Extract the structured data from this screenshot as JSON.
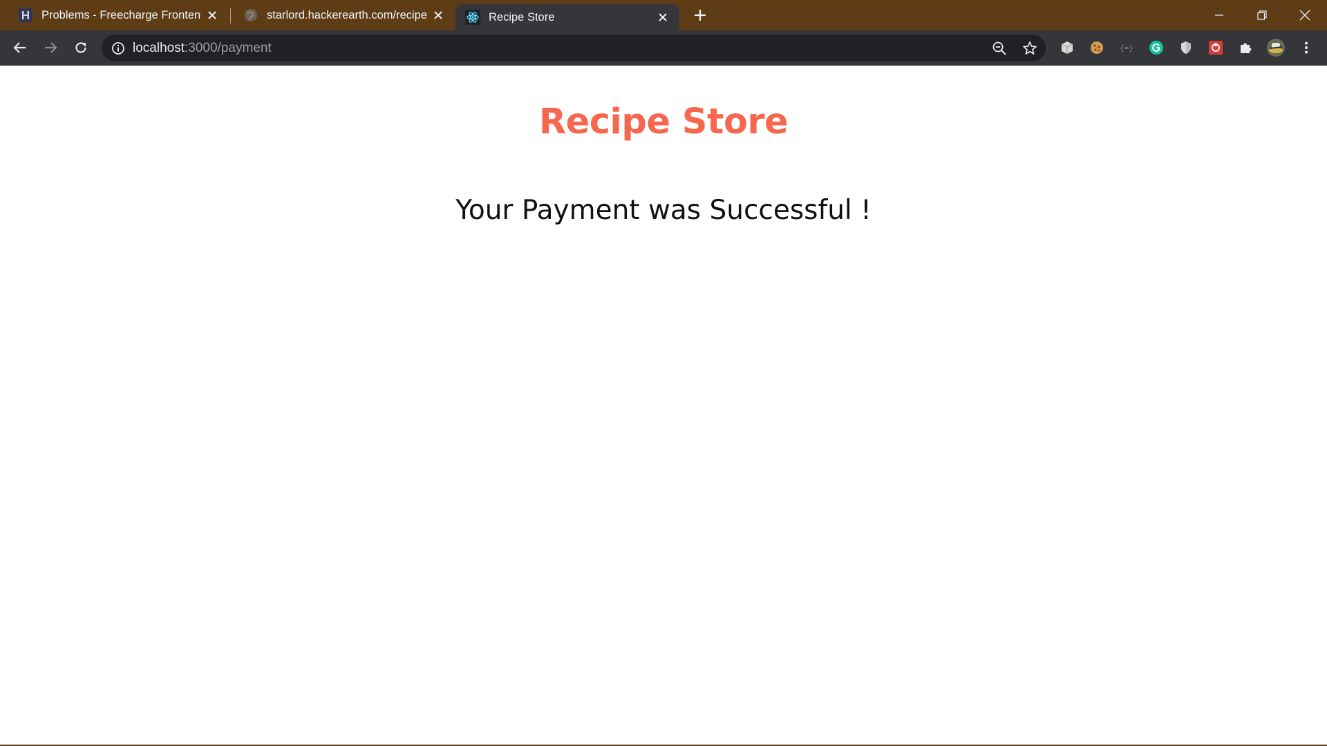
{
  "browser": {
    "tabs": [
      {
        "label": "Problems - Freecharge Frontend",
        "favicon": "hackerearth-icon",
        "active": false
      },
      {
        "label": "starlord.hackerearth.com/recipe",
        "favicon": "globe-icon",
        "active": false
      },
      {
        "label": "Recipe Store",
        "favicon": "react-icon",
        "active": true
      }
    ],
    "address_bar": {
      "host": "localhost",
      "path": ":3000/payment"
    },
    "extensions": [
      "cube-extension-icon",
      "cookie-extension-icon",
      "json-extension-icon",
      "grammarly-icon",
      "shield-extension-icon",
      "red-extension-icon",
      "puzzle-icon",
      "profile-avatar-icon",
      "menu-icon"
    ]
  },
  "page": {
    "brand_title": "Recipe Store",
    "message": "Your Payment was Successful !"
  },
  "colors": {
    "titlebar": "#5e3c16",
    "toolbar": "#35363a",
    "brand": "#f6674e"
  }
}
